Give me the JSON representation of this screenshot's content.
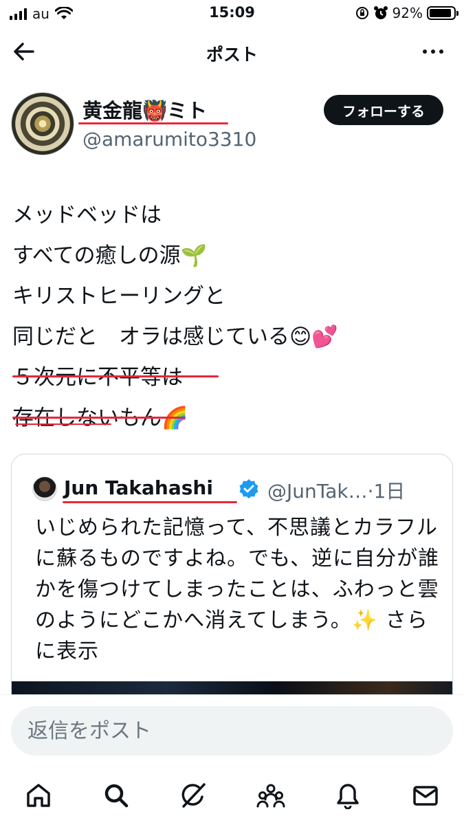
{
  "status_bar": {
    "carrier": "au",
    "time": "15:09",
    "battery": "92%",
    "battery_level": 0.92
  },
  "header": {
    "title": "ポスト"
  },
  "author": {
    "name": "黄金龍👹ミト",
    "handle": "@amarumito3310",
    "follow_label": "フォローする"
  },
  "post": {
    "lines": [
      "メッドベッドは",
      "すべての癒しの源🌱",
      "キリストヒーリングと",
      "同じだと　オラは感じている😊💕",
      "５次元に不平等は",
      "存在しないもん🌈"
    ]
  },
  "quote": {
    "name": "Jun Takahashi",
    "handle": "@JunTak…·1日",
    "text": "いじめられた記憶って、不思議とカラフルに蘇るものですよね。でも、逆に自分が誰かを傷つけてしまったことは、ふわっと雲のようにどこかへ消えてしまう。✨",
    "more_label": " さらに表示"
  },
  "reply": {
    "placeholder": "返信をポスト"
  },
  "tabs": [
    "home",
    "search",
    "grok",
    "communities",
    "notifications",
    "messages"
  ]
}
